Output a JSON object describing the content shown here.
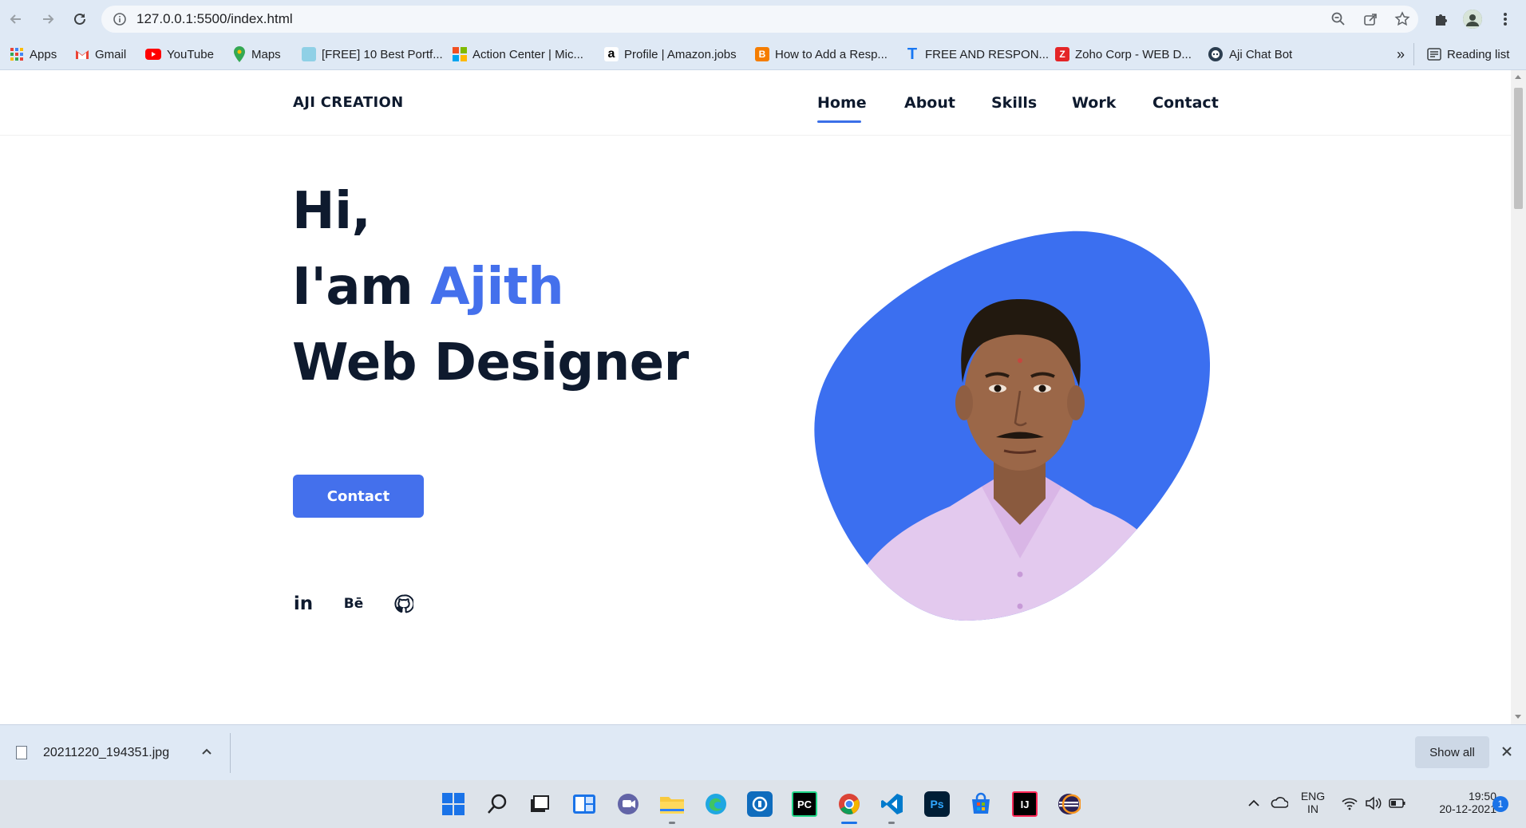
{
  "browser": {
    "url": "127.0.0.1:5500/index.html",
    "bookmarks": [
      {
        "label": "Apps",
        "icon": "apps-grid-icon",
        "color": "#4285f4"
      },
      {
        "label": "Gmail",
        "icon": "gmail-icon",
        "color": "#ea4335"
      },
      {
        "label": "YouTube",
        "icon": "youtube-icon",
        "color": "#ff0000"
      },
      {
        "label": "Maps",
        "icon": "maps-pin-icon",
        "color": "#34a853"
      },
      {
        "label": "[FREE] 10 Best Portf...",
        "icon": "portfolio-icon",
        "color": "#2fa7c7"
      },
      {
        "label": "Action Center | Mic...",
        "icon": "microsoft-icon",
        "color": "#f25022"
      },
      {
        "label": "Profile | Amazon.jobs",
        "icon": "amazon-icon",
        "color": "#000000"
      },
      {
        "label": "How to Add a Resp...",
        "icon": "blogger-icon",
        "color": "#f57d00"
      },
      {
        "label": "FREE AND RESPON...",
        "icon": "t-icon",
        "color": "#1877f2"
      },
      {
        "label": "Zoho Corp - WEB D...",
        "icon": "zoho-icon",
        "color": "#e42527"
      },
      {
        "label": "Aji Chat Bot",
        "icon": "chatbot-icon",
        "color": "#2c3e50"
      }
    ],
    "more_bookmarks": "»",
    "reading_list": "Reading list"
  },
  "site": {
    "logo": "AJI CREATION",
    "nav": [
      {
        "label": "Home",
        "active": true
      },
      {
        "label": "About",
        "active": false
      },
      {
        "label": "Skills",
        "active": false
      },
      {
        "label": "Work",
        "active": false
      },
      {
        "label": "Contact",
        "active": false
      }
    ],
    "hero": {
      "line1": "Hi,",
      "line2_prefix": "I'am ",
      "line2_name": "Ajith",
      "line3": "Web Designer",
      "cta": "Contact"
    },
    "social_icons": [
      "linkedin-icon",
      "behance-icon",
      "github-icon"
    ],
    "social_text": {
      "linkedin": "in",
      "behance": "Bē"
    },
    "accent_color": "#4470ec",
    "heading_color": "#0e1a2e"
  },
  "downloads": {
    "file": "20211220_194351.jpg",
    "show_all": "Show all"
  },
  "taskbar": {
    "apps": [
      {
        "name": "start-icon",
        "label": ""
      },
      {
        "name": "search-icon",
        "label": ""
      },
      {
        "name": "task-view-icon",
        "label": ""
      },
      {
        "name": "widgets-icon",
        "label": ""
      },
      {
        "name": "teams-chat-icon",
        "label": ""
      },
      {
        "name": "file-explorer-icon",
        "label": ""
      },
      {
        "name": "edge-icon",
        "label": ""
      },
      {
        "name": "app-icon",
        "label": ""
      },
      {
        "name": "pycharm-icon",
        "label": "PC"
      },
      {
        "name": "chrome-icon",
        "label": ""
      },
      {
        "name": "vscode-icon",
        "label": ""
      },
      {
        "name": "photoshop-icon",
        "label": "Ps"
      },
      {
        "name": "store-icon",
        "label": ""
      },
      {
        "name": "intellij-icon",
        "label": "IJ"
      },
      {
        "name": "eclipse-icon",
        "label": ""
      }
    ],
    "lang_top": "ENG",
    "lang_bottom": "IN",
    "time": "19:50",
    "date": "20-12-2021",
    "notification_count": "1"
  }
}
